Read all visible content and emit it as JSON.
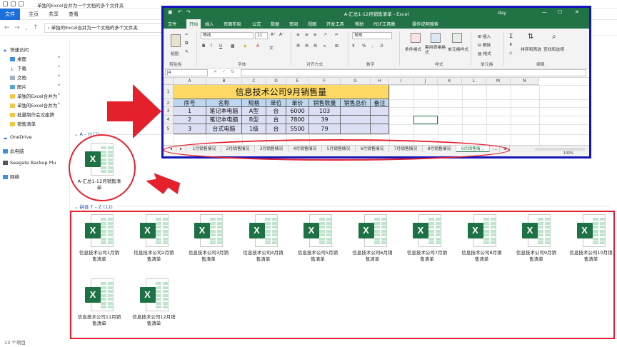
{
  "explorer": {
    "window_title": "单独的Excel合并为一个文档的多个文件夹",
    "ribbon_tabs": [
      "文件",
      "主页",
      "共享",
      "查看"
    ],
    "address_path": "单独的Excel合并为一个文档的多个文件夹",
    "nav": {
      "quick_access": "快速访问",
      "items": [
        "桌面",
        "下载",
        "文档",
        "图片",
        "单独的Excel合并为",
        "单独的Excel合并为",
        "批量制作会议座牌",
        "销售清单"
      ],
      "onedrive": "OneDrive",
      "this_pc": "此电脑",
      "seagate": "Seagate Backup Plu",
      "network": "网络"
    },
    "group_ah": "A – H (1)",
    "group_tz": "拼音 T – Z (12)",
    "summary_file": "A-汇总1-12月销售清单",
    "files": [
      "信息技术公司1月销售清单",
      "信息技术公司2月销售清单",
      "信息技术公司3月销售清单",
      "信息技术公司4月销售清单",
      "信息技术公司5月销售清单",
      "信息技术公司6月销售清单",
      "信息技术公司7月销售清单",
      "信息技术公司8月销售清单",
      "信息技术公司9月销售清单",
      "信息技术公司10月销售清单",
      "信息技术公司11月销售清单",
      "信息技术公司12月销售清单"
    ],
    "status": "13 个项目"
  },
  "excel": {
    "title": "A-汇总1-12月销售清单 - Excel",
    "user": "day",
    "tabs": [
      "文件",
      "开始",
      "插入",
      "页面布局",
      "公式",
      "数据",
      "审阅",
      "视图",
      "开发工具",
      "帮助",
      "PDF工具集",
      "操作说明搜索"
    ],
    "ribbon": {
      "font_name": "等线",
      "font_size": "11",
      "number_format": "常规",
      "groups": [
        "剪贴板",
        "字体",
        "对齐方式",
        "数字",
        "样式",
        "单元格",
        "编辑"
      ],
      "paste": "粘贴",
      "cond_format": "条件格式",
      "table_format": "套用表格格式",
      "cell_style": "单元格样式",
      "insert": "插入",
      "delete": "删除",
      "format": "格式",
      "sort_filter": "排序和筛选",
      "find_select": "查找和选择",
      "sum": "Σ"
    },
    "name_box": "J4",
    "columns": [
      "A",
      "B",
      "C",
      "D",
      "E",
      "F",
      "G",
      "H",
      "I",
      "J",
      "K",
      "L",
      "M",
      "N"
    ],
    "rows": [
      "1",
      "2",
      "3",
      "4",
      "5"
    ],
    "table_title": "信息技术公司9月销售量",
    "headers": [
      "序号",
      "名称",
      "规格",
      "单位",
      "单价",
      "销售数量",
      "销售总价",
      "备注"
    ],
    "data_rows": [
      [
        "1",
        "笔记本电脑",
        "A型",
        "台",
        "6000",
        "103",
        "",
        ""
      ],
      [
        "2",
        "笔记本电脑",
        "B型",
        "台",
        "7800",
        "39",
        "",
        ""
      ],
      [
        "3",
        "台式电脑",
        "1级",
        "台",
        "5500",
        "79",
        "",
        ""
      ]
    ],
    "sheets": [
      "1月销售情况",
      "2月销售情况",
      "3月销售情况",
      "4月销售情况",
      "5月销售情况",
      "6月销售情况",
      "7月销售情况",
      "8月销售情况",
      "9月销售情..."
    ],
    "zoom": "100%"
  },
  "colors": {
    "excel_green": "#217346",
    "title_fill": "#ffd966",
    "header_fill": "#bdd7ee",
    "row_fill": "#dde0f4",
    "annotation_red": "#e5202d",
    "window_border": "#1515b8"
  }
}
